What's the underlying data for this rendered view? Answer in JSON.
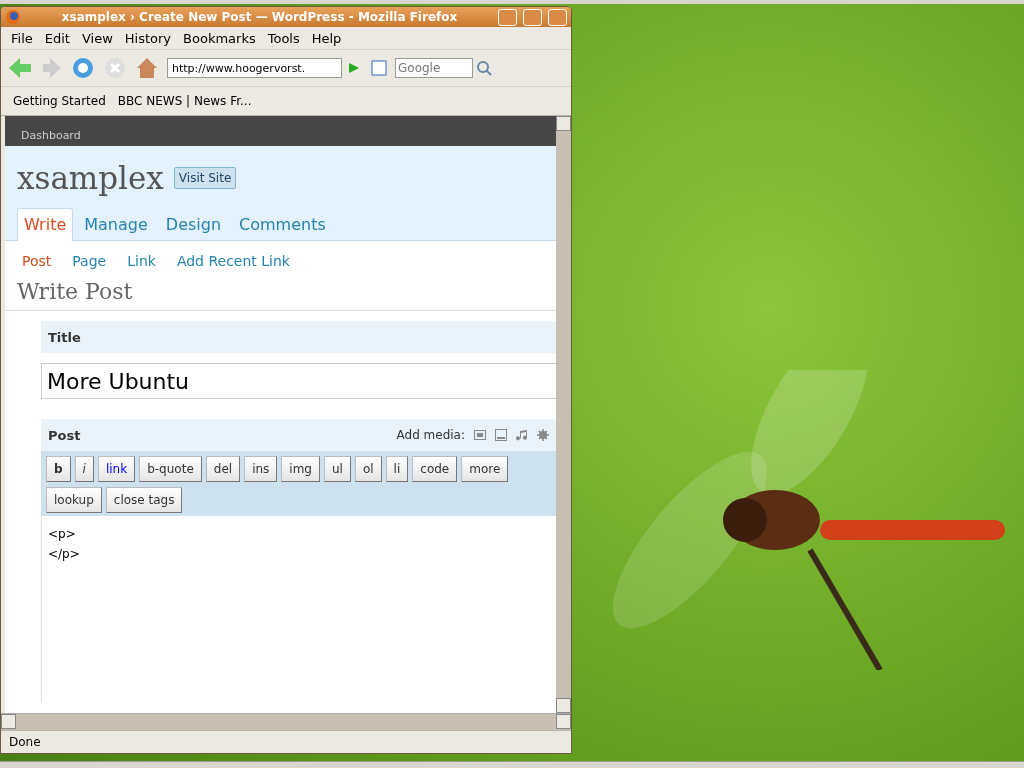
{
  "window": {
    "title": "xsamplex › Create New Post — WordPress - Mozilla Firefox"
  },
  "menu": [
    "File",
    "Edit",
    "View",
    "History",
    "Bookmarks",
    "Tools",
    "Help"
  ],
  "address": {
    "value": "http://www.hoogervorst."
  },
  "search": {
    "placeholder": "Google"
  },
  "bookmarks": [
    "Getting Started",
    "BBC NEWS | News Fr..."
  ],
  "page": {
    "dashboard": "Dashboard",
    "site_title": "xsamplex",
    "visit_site": "Visit Site",
    "tabs": [
      {
        "label": "Write",
        "selected": true
      },
      {
        "label": "Manage",
        "selected": false
      },
      {
        "label": "Design",
        "selected": false
      },
      {
        "label": "Comments",
        "selected": false
      }
    ],
    "subtabs": [
      {
        "label": "Post",
        "selected": true
      },
      {
        "label": "Page",
        "selected": false
      },
      {
        "label": "Link",
        "selected": false
      },
      {
        "label": "Add Recent Link",
        "selected": false
      }
    ],
    "heading": "Write Post",
    "title_label": "Title",
    "title_value": "More Ubuntu",
    "post_label": "Post",
    "add_media": "Add media:",
    "toolbar": [
      {
        "label": "b",
        "kind": "bold"
      },
      {
        "label": "i",
        "kind": "italic"
      },
      {
        "label": "link",
        "kind": "link"
      },
      {
        "label": "b-quote",
        "kind": "plain"
      },
      {
        "label": "del",
        "kind": "plain"
      },
      {
        "label": "ins",
        "kind": "plain"
      },
      {
        "label": "img",
        "kind": "plain"
      },
      {
        "label": "ul",
        "kind": "plain"
      },
      {
        "label": "ol",
        "kind": "plain"
      },
      {
        "label": "li",
        "kind": "plain"
      },
      {
        "label": "code",
        "kind": "plain"
      },
      {
        "label": "more",
        "kind": "plain"
      },
      {
        "label": "lookup",
        "kind": "plain"
      },
      {
        "label": "close tags",
        "kind": "plain"
      }
    ],
    "editor_lines": [
      "<p>",
      "</p>"
    ]
  },
  "status_bar": "Done"
}
